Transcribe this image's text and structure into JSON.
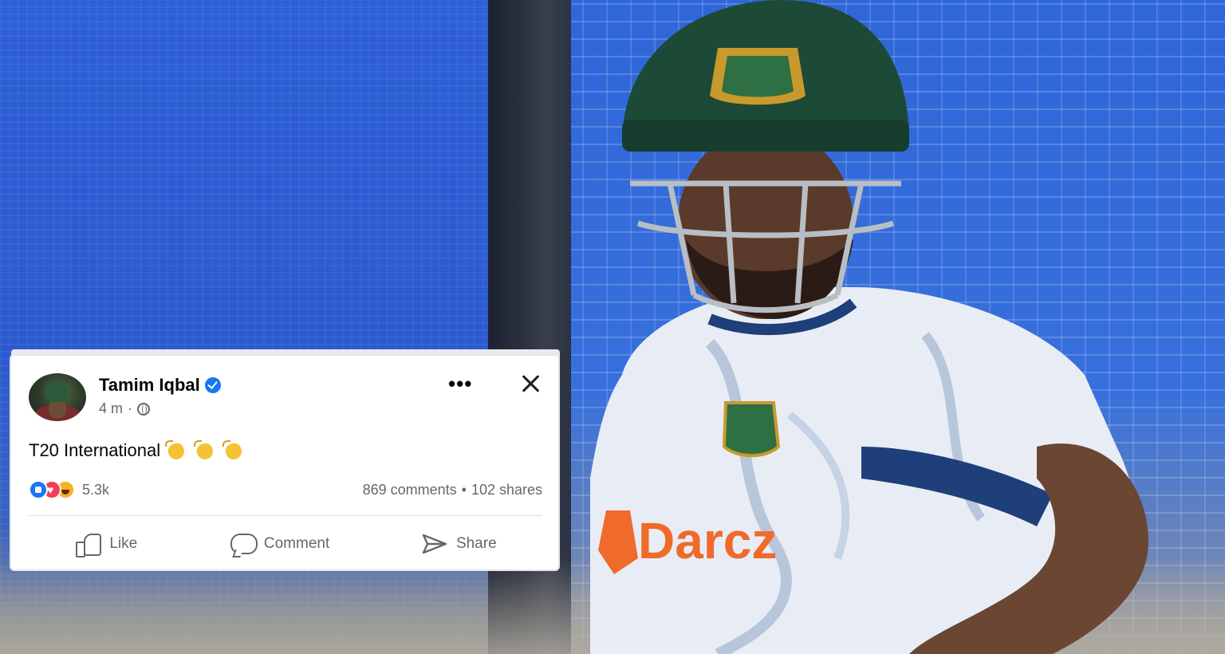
{
  "post": {
    "author": "Tamim Iqbal",
    "verified": true,
    "time": "4 m",
    "privacy_icon": "globe-icon",
    "text": "T20 International",
    "emojis": [
      "clapping-hands-emoji",
      "clapping-hands-emoji",
      "clapping-hands-emoji"
    ],
    "reactions": {
      "icons": [
        "like-reaction-icon",
        "love-reaction-icon",
        "haha-reaction-icon"
      ],
      "count": "5.3k"
    },
    "comments": "869 comments",
    "separator": "•",
    "shares": "102 shares"
  },
  "actions": {
    "like": "Like",
    "comment": "Comment",
    "share": "Share"
  },
  "colors": {
    "accent": "#1877f2",
    "secondary_text": "#65676b",
    "love": "#f33e58",
    "haha": "#f7b125",
    "net_blue": "#2f66d8"
  }
}
